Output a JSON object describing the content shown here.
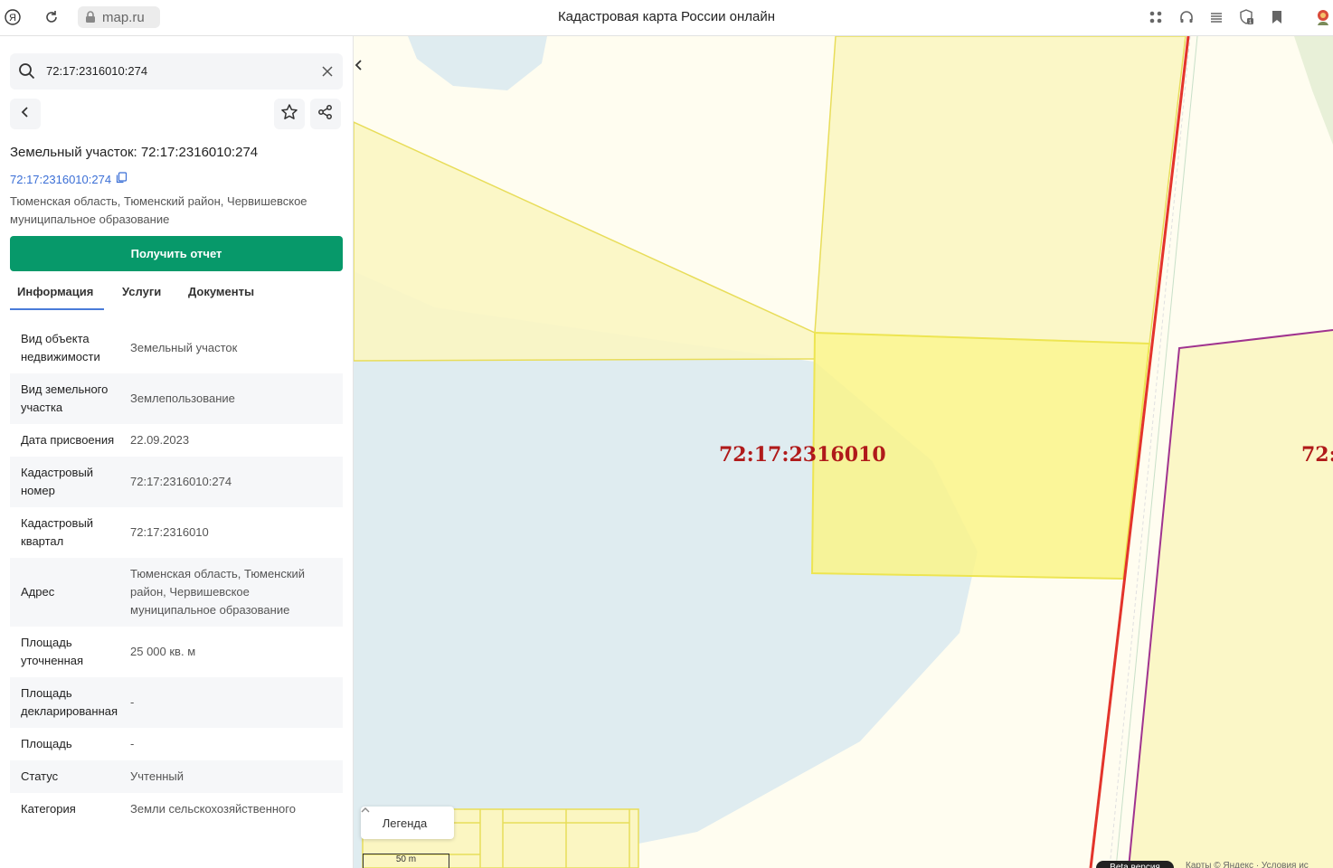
{
  "browser": {
    "url": "map.ru",
    "title": "Кадастровая карта России онлайн",
    "icons": [
      "yandex-logo-icon",
      "reload-icon",
      "lock-icon",
      "apps-icon",
      "headphones-icon",
      "reader-icon",
      "shield-icon",
      "bookmark-icon",
      "profile-icon"
    ]
  },
  "search": {
    "value": "72:17:2316010:274"
  },
  "object": {
    "title": "Земельный участок: 72:17:2316010:274",
    "link": "72:17:2316010:274",
    "address": "Тюменская область, Тюменский район, Червишевское муниципальное образование"
  },
  "report_button": "Получить отчет",
  "tabs": [
    "Информация",
    "Услуги",
    "Документы"
  ],
  "active_tab": "Информация",
  "info_rows": [
    {
      "key": "Вид объекта недвижимости",
      "value": "Земельный участок"
    },
    {
      "key": "Вид земельного участка",
      "value": "Землепользование"
    },
    {
      "key": "Дата присвоения",
      "value": "22.09.2023"
    },
    {
      "key": "Кадастровый номер",
      "value": "72:17:2316010:274"
    },
    {
      "key": "Кадастровый квартал",
      "value": "72:17:2316010"
    },
    {
      "key": "Адрес",
      "value": "Тюменская область, Тюменский район, Червишевское муниципальное образование"
    },
    {
      "key": "Площадь уточненная",
      "value": "25 000 кв. м"
    },
    {
      "key": "Площадь декларированная",
      "value": "-"
    },
    {
      "key": "Площадь",
      "value": "-"
    },
    {
      "key": "Статус",
      "value": "Учтенный"
    },
    {
      "key": "Категория",
      "value": "Земли сельскохозяйственного"
    }
  ],
  "map": {
    "quarter_label": "72:17:2316010",
    "quarter_label_right": "72:",
    "legend_label": "Легенда",
    "scale_label": "50 m",
    "beta_label": "Beta версия",
    "copyright": "Карты © Яндекс · Условия ис",
    "colors": {
      "parcel_fill": "#faf58a",
      "boundary_red": "#e3342b",
      "boundary_purple": "#a0338f",
      "water": "#dfecf0"
    }
  }
}
